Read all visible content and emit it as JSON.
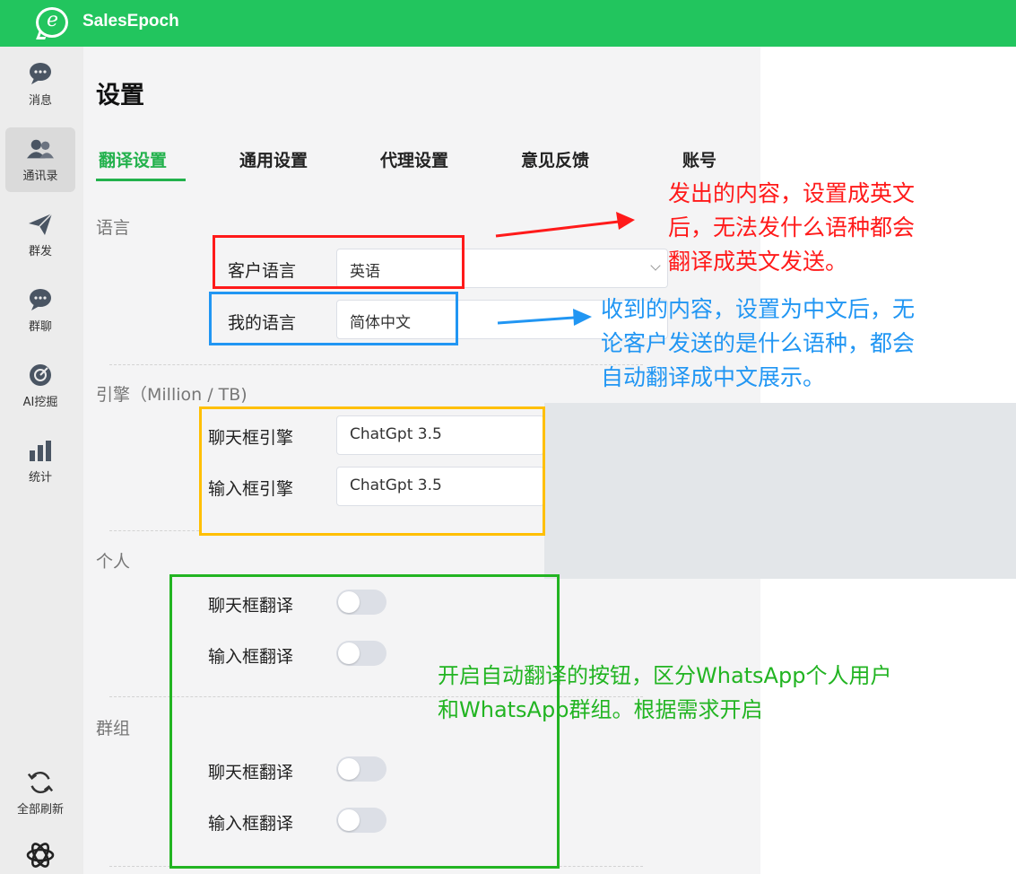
{
  "app": {
    "title": "SalesEpoch",
    "logo_letter": "e"
  },
  "sidebar": {
    "items": [
      {
        "label": "消息",
        "icon": "chat-bubble-icon"
      },
      {
        "label": "通讯录",
        "icon": "contacts-icon"
      },
      {
        "label": "群发",
        "icon": "send-plane-icon"
      },
      {
        "label": "群聊",
        "icon": "group-chat-icon"
      },
      {
        "label": "AI挖掘",
        "icon": "ai-target-icon"
      },
      {
        "label": "统计",
        "icon": "bar-chart-icon"
      }
    ],
    "refresh_label": "全部刷新",
    "refresh_icon": "refresh-icon",
    "bottom_icon": "openai-icon"
  },
  "page": {
    "title": "设置"
  },
  "tabs": [
    {
      "label": "翻译设置",
      "active": true
    },
    {
      "label": "通用设置",
      "active": false
    },
    {
      "label": "代理设置",
      "active": false
    },
    {
      "label": "意见反馈",
      "active": false
    },
    {
      "label": "账号",
      "active": false
    }
  ],
  "language": {
    "section_title": "语言",
    "customer_label": "客户语言",
    "customer_value": "英语",
    "my_label": "我的语言",
    "my_value": "简体中文"
  },
  "engine": {
    "section_title": "引擎（Million / TB)",
    "chat_label": "聊天框引擎",
    "chat_value": "ChatGpt 3.5",
    "input_label": "输入框引擎",
    "input_value": "ChatGpt 3.5"
  },
  "personal": {
    "section_title": "个人",
    "chat_label": "聊天框翻译",
    "chat_on": false,
    "input_label": "输入框翻译",
    "input_on": false
  },
  "group": {
    "section_title": "群组",
    "chat_label": "聊天框翻译",
    "chat_on": false,
    "input_label": "输入框翻译",
    "input_on": false
  },
  "annotations": {
    "red": {
      "lines": [
        "发出的内容，设置成英文",
        "后，无法发什么语种都会",
        "翻译成英文发送。"
      ],
      "color": "#ff1a1a"
    },
    "blue": {
      "lines": [
        "收到的内容，设置为中文后，无",
        "论客户发送的是什么语种，都会",
        "自动翻译成中文展示。"
      ],
      "color": "#2196f3"
    },
    "green": {
      "lines": [
        "开启自动翻译的按钮，区分WhatsApp个人用户",
        "和WhatsApp群组。根据需求开启"
      ],
      "color": "#22b422"
    },
    "yellow_color": "#ffbf00"
  },
  "colors": {
    "brand": "#22c55e",
    "tab_active": "#22b14c"
  }
}
